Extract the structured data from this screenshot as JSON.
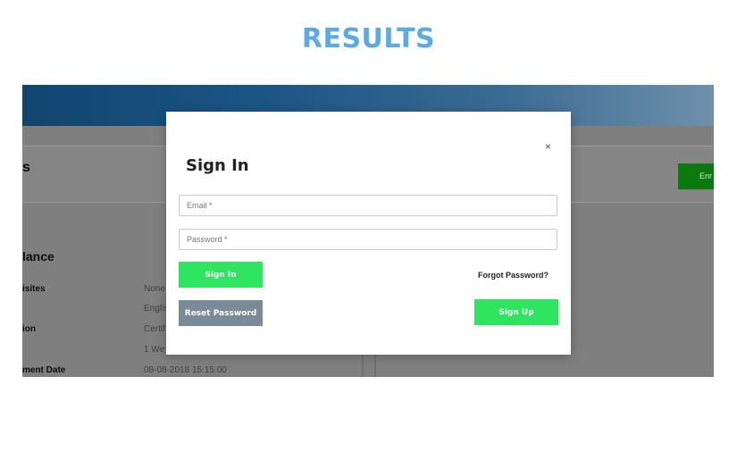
{
  "page": {
    "heading": "RESULTS"
  },
  "background": {
    "section_heading": "s",
    "enroll_label": "Enr",
    "subheading": "lance",
    "rows": [
      {
        "label": "isites",
        "value": "None"
      },
      {
        "label": "",
        "value": "Englis"
      },
      {
        "label": "ion",
        "value": "Certif"
      },
      {
        "label": "",
        "value": "1 We"
      },
      {
        "label": "ment Date",
        "value": "08-08-2018 15:15:00"
      }
    ]
  },
  "modal": {
    "title": "Sign In",
    "close_symbol": "×",
    "email_placeholder": "Email *",
    "password_placeholder": "Password *",
    "signin_label": "Sign In",
    "forgot_label": "Forgot Password?",
    "reset_label": "Reset Password",
    "signup_label": "Sign Up"
  },
  "colors": {
    "heading": "#5aabe5",
    "primary_button": "#2ee55f",
    "secondary_button": "#7a8a96",
    "enroll_button": "#0a7a0f"
  }
}
